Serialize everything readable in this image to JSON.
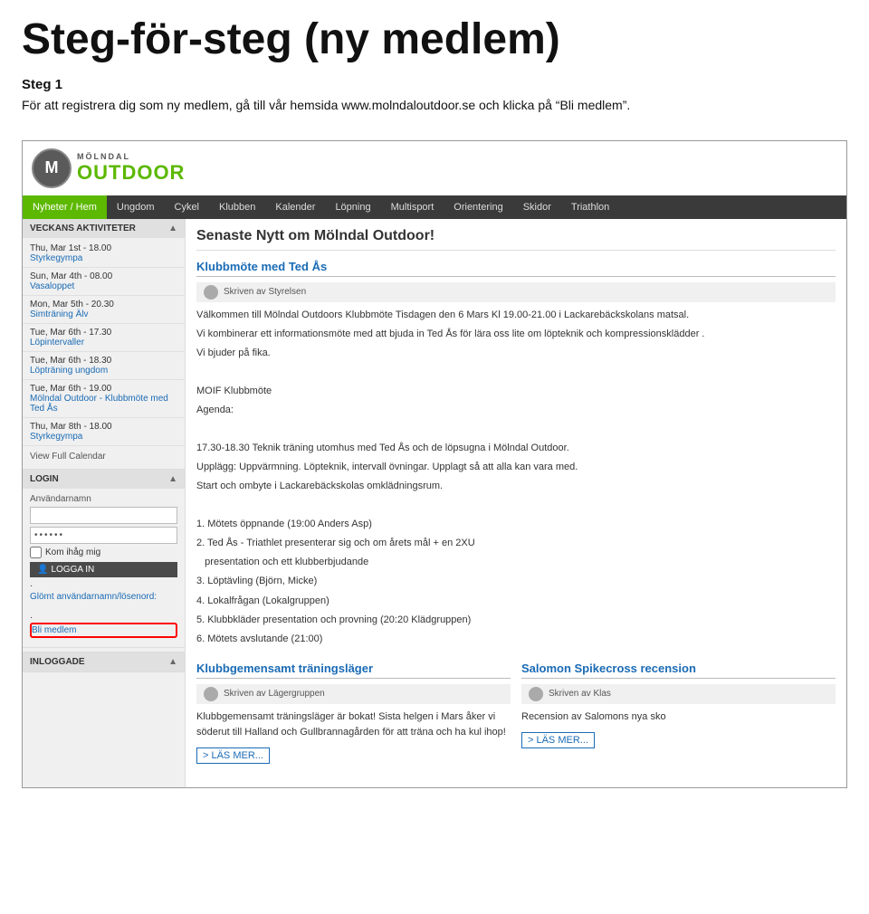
{
  "page": {
    "main_title": "Steg-för-steg (ny medlem)",
    "step1_heading": "Steg 1",
    "step1_text": "För att registrera dig som ny medlem, gå till vår hemsida www.molndaloutdoor.se och klicka på “Bli medlem”."
  },
  "site": {
    "logo_m": "M",
    "logo_molndal": "MÖLNDAL",
    "logo_outdoor": "OUTDOOR",
    "nav": [
      {
        "label": "Nyheter / Hem",
        "active": true
      },
      {
        "label": "Ungdom",
        "active": false
      },
      {
        "label": "Cykel",
        "active": false
      },
      {
        "label": "Klubben",
        "active": false
      },
      {
        "label": "Kalender",
        "active": false
      },
      {
        "label": "Löpning",
        "active": false
      },
      {
        "label": "Multisport",
        "active": false
      },
      {
        "label": "Orientering",
        "active": false
      },
      {
        "label": "Skidor",
        "active": false
      },
      {
        "label": "Triathlon",
        "active": false
      }
    ],
    "sidebar": {
      "veckans_heading": "VECKANS AKTIVITETER",
      "events": [
        {
          "date": "Thu, Mar 1st - 18.00",
          "link": "Styrkegympa"
        },
        {
          "date": "Sun, Mar 4th - 08.00",
          "link": "Vasaloppet"
        },
        {
          "date": "Mon, Mar 5th - 20.30",
          "link": "Simträning Älv"
        },
        {
          "date": "Tue, Mar 6th - 17.30",
          "link": "Löpintervaller"
        },
        {
          "date": "Tue, Mar 6th - 18.30",
          "link": "Löpträning ungdom"
        },
        {
          "date": "Tue, Mar 6th - 19.00",
          "link": "Mölndal Outdoor - Klubbmöte med Ted Ås"
        },
        {
          "date": "Thu, Mar 8th - 18.00",
          "link": "Styrkegympa"
        }
      ],
      "view_full_calendar": "View Full Calendar",
      "login_heading": "LOGIN",
      "username_label": "Användarnamn",
      "password_placeholder": "••••••",
      "remember_label": "Kom ihåg mig",
      "login_button": "LOGGA IN",
      "forgot_link": "Glömt användarnamn/lösenord:",
      "bli_medlem_link": "Bli medlem",
      "inloggade_heading": "INLOGGADE"
    },
    "main": {
      "heading": "Senaste Nytt om Mölndal Outdoor!",
      "article1": {
        "title": "Klubbmöte med Ted Ås",
        "author": "Skriven av Styrelsen",
        "body_lines": [
          "Välkommen till Mölndal Outdoors Klubbmöte Tisdagen den  6 Mars Kl 19.00-21.00 i Lackarebäckskolans matsal.",
          "Vi kombinerar ett informationsmöte med att bjuda in Ted Ås för lära oss lite om löpteknik och kompressionsklädder .",
          "Vi bjuder på fika.",
          "",
          "MOIF Klubbmöte",
          "Agenda:",
          "",
          "17.30-18.30 Teknik träning utomhus med Ted Ås och de löpsugna i Mölndal Outdoor.",
          "Upplägg: Uppvärmning. Löpteknik, intervall övningar. Upplagt så att alla kan vara med.",
          "Start och ombyte i Lackarebäckskolas omklädningsrum.",
          "",
          "1. Mötets öppnande (19:00 Anders Asp)",
          "2. Ted Ås - Triathlet presenterar sig och om årets mål + en 2XU",
          "   presentation och ett klubberbjudande",
          "3. Löptävling (Björn, Micke)",
          "4. Lokalfrågan (Lokalgruppen)",
          "5. Klubbkläder presentation och provning (20:20 Klädgruppen)",
          "6. Mötets avslutande (21:00)"
        ]
      },
      "article2": {
        "title": "Klubbgemensamt träningsläger",
        "author": "Skriven av Lägergruppen",
        "body": "Klubbgemensamt träningsläger är bokat! Sista helgen i Mars åker vi söderut till Halland och Gullbrannagården för att träna och ha kul ihop!",
        "las_mer": "> LÄS MER..."
      },
      "article3": {
        "title": "Salomon Spikecross recension",
        "author": "Skriven av Klas",
        "body": "Recension av Salomons nya sko",
        "las_mer": "> LÄS MER..."
      }
    }
  }
}
